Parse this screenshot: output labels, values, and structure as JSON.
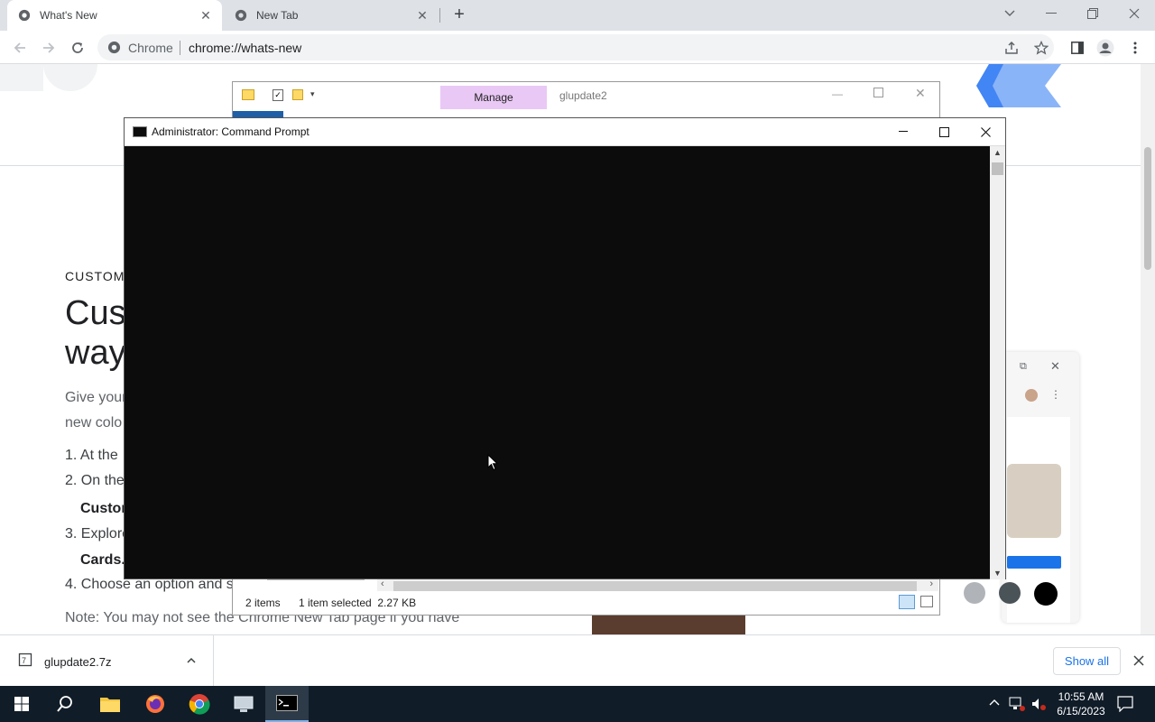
{
  "browser": {
    "tabs": [
      {
        "title": "What's New",
        "active": true
      },
      {
        "title": "New Tab",
        "active": false
      }
    ],
    "omnibox": {
      "site": "Chrome",
      "url": "chrome://whats-new"
    }
  },
  "page": {
    "section_label": "CUSTOMI",
    "heading_lines": [
      "Cust",
      "way"
    ],
    "para_lines": [
      "Give your",
      "new colo"
    ],
    "steps": [
      "1. At the",
      "2. On the",
      "3. Explore",
      "4. Choose an option and s"
    ],
    "bold_lines": [
      "Custon",
      "Cards."
    ],
    "note": "Note: You may not see the Chrome New Tab page if you have"
  },
  "explorer": {
    "manage_label": "Manage",
    "title": "glupdate2",
    "status_items": "2 items",
    "status_selected": "1 item selected  2.27 KB"
  },
  "cmd": {
    "title": "Administrator:  Command Prompt"
  },
  "downloads": {
    "file": "glupdate2.7z",
    "show_all": "Show all"
  },
  "taskbar": {
    "time": "10:55 AM",
    "date": "6/15/2023"
  },
  "colors": {
    "tabstrip": "#dee1e6",
    "cmd_bg": "#0c0c0c",
    "manage_tab": "#e9c8f5",
    "taskbar": "#101c28",
    "link_blue": "#1a73e8"
  }
}
